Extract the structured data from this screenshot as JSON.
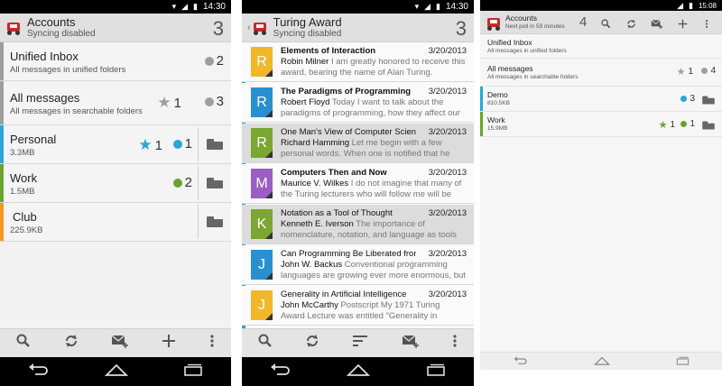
{
  "status": {
    "time1": "14:30",
    "time2": "14:30",
    "time3": "15:08"
  },
  "phone1": {
    "title": "Accounts",
    "subtitle": "Syncing disabled",
    "count": "3",
    "folders": [
      {
        "name": "Unified Inbox",
        "sub": "All messages in unified folders",
        "count": "2",
        "stripe": "#9e9e9e"
      },
      {
        "name": "All messages",
        "sub": "All messages in searchable folders",
        "star_count": "1",
        "count": "3",
        "stripe": "#9e9e9e"
      },
      {
        "name": "Personal",
        "sub": "3.3MB",
        "star_count": "1",
        "count": "1",
        "stripe": "#2aa6d8"
      },
      {
        "name": "Work",
        "sub": "1.5MB",
        "count": "2",
        "stripe": "#6aa32b"
      },
      {
        "name": "Club",
        "sub": "225.9KB",
        "stripe": "#f39a1f"
      }
    ]
  },
  "phone2": {
    "title": "Turing Award",
    "subtitle": "Syncing disabled",
    "count": "3",
    "messages": [
      {
        "letter": "R",
        "color": "#f0b72a",
        "subject": "Elements of Interaction",
        "date": "3/20/2013",
        "sender": "Robin Milner",
        "preview": "I am greatly honored to receive this award, bearing the name of Alan Turing. Perhaps",
        "bold": true,
        "selected": false
      },
      {
        "letter": "R",
        "color": "#2a8fd1",
        "subject": "The Paradigms of Programming",
        "date": "3/20/2013",
        "sender": "Robert Floyd",
        "preview": "Today I want to talk about the paradigms of programming, how they affect our",
        "bold": true,
        "selected": false
      },
      {
        "letter": "R",
        "color": "#7aa631",
        "subject": "One Man's View of Computer Science",
        "date": "3/20/2013",
        "sender": "Richard Hamming",
        "preview": "Let me begin with a few personal words. When one is notified that he has",
        "bold": false,
        "selected": true
      },
      {
        "letter": "M",
        "color": "#9c5ec4",
        "subject": "Computers Then and Now",
        "date": "3/20/2013",
        "sender": "Maurice V. Wilkes",
        "preview": "I do not imagine that many of the Turing lecturers who will follow me will be",
        "bold": true,
        "selected": false
      },
      {
        "letter": "K",
        "color": "#7aa631",
        "subject": "Notation as a Tool of Thought",
        "date": "3/20/2013",
        "sender": "Kenneth E. Iverson",
        "preview": "The importance of nomenclature, notation, and language as tools of",
        "bold": false,
        "selected": true
      },
      {
        "letter": "J",
        "color": "#2a8fd1",
        "subject": "Can Programming Be Liberated from...",
        "date": "3/20/2013",
        "sender": "John W. Backus",
        "preview": "Conventional programming languages are growing ever more enormous, but",
        "bold": false,
        "selected": false
      },
      {
        "letter": "J",
        "color": "#f0b72a",
        "subject": "Generality in Artificial Intelligence",
        "date": "3/20/2013",
        "sender": "John McCarthy",
        "preview": "Postscript My 1971 Turing Award Lecture was entitled \"Generality in Artificial",
        "bold": false,
        "selected": false
      }
    ]
  },
  "phone3": {
    "title": "Accounts",
    "subtitle": "Next poll in 59 minutes",
    "count": "4",
    "folders": [
      {
        "name": "Unified Inbox",
        "sub": "All messages in unified folders"
      },
      {
        "name": "All messages",
        "sub": "All messages in searchable folders",
        "star_count": "1",
        "count": "4"
      },
      {
        "name": "Demo",
        "sub": "810.5KB",
        "count": "3"
      },
      {
        "name": "Work",
        "sub": "15.9MB",
        "star_count": "1",
        "count": "1"
      }
    ]
  },
  "icons": {
    "search": "search-icon",
    "refresh": "refresh-icon",
    "compose": "compose-icon",
    "add": "add-icon",
    "overflow": "overflow-menu-icon",
    "sort": "sort-icon",
    "back": "back-icon",
    "home": "home-icon",
    "recents": "recents-icon",
    "star": "star-icon",
    "folder": "folder-icon",
    "app": "app-icon",
    "wifi": "wifi-icon",
    "signal": "signal-icon",
    "battery": "battery-icon"
  },
  "colors": {
    "accent_blue": "#2aa6d8",
    "green": "#6aa32b",
    "orange": "#f39a1f",
    "gray_dot": "#9e9e9e"
  }
}
